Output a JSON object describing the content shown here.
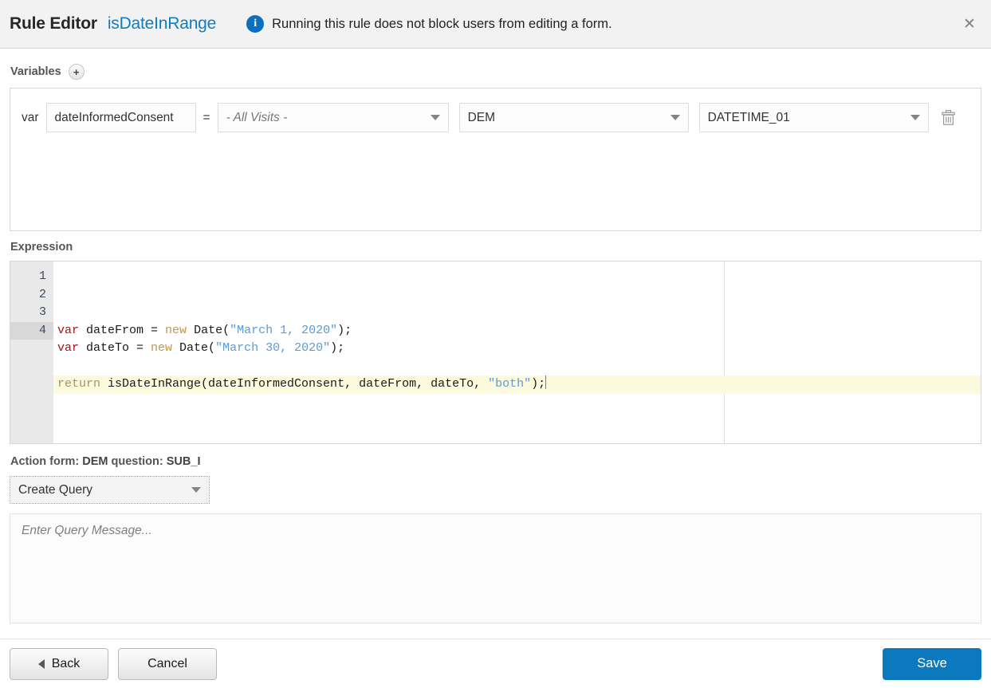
{
  "header": {
    "title": "Rule Editor",
    "rule_name": "isDateInRange",
    "info_icon": "info-circle-icon",
    "note": "Running this rule does not block users from editing a form.",
    "close_label": "✕"
  },
  "variables": {
    "label": "Variables",
    "add_label": "+",
    "rows": [
      {
        "keyword": "var",
        "name": "dateInformedConsent",
        "equals": "=",
        "visit": "- All Visits -",
        "visit_is_placeholder": true,
        "form": "DEM",
        "item": "DATETIME_01",
        "delete_icon": "trash-icon"
      }
    ]
  },
  "expression": {
    "label": "Expression",
    "active_line": 4,
    "cursor_line": 4,
    "lines": [
      {
        "number": "1",
        "tokens": [
          {
            "t": "var ",
            "c": "tok-kw"
          },
          {
            "t": "dateFrom = ",
            "c": "tok-plain"
          },
          {
            "t": "new ",
            "c": "tok-new"
          },
          {
            "t": "Date(",
            "c": "tok-plain"
          },
          {
            "t": "\"March 1, 2020\"",
            "c": "tok-str"
          },
          {
            "t": ");",
            "c": "tok-plain"
          }
        ]
      },
      {
        "number": "2",
        "tokens": [
          {
            "t": "var ",
            "c": "tok-kw"
          },
          {
            "t": "dateTo = ",
            "c": "tok-plain"
          },
          {
            "t": "new ",
            "c": "tok-new"
          },
          {
            "t": "Date(",
            "c": "tok-plain"
          },
          {
            "t": "\"March 30, 2020\"",
            "c": "tok-str"
          },
          {
            "t": ");",
            "c": "tok-plain"
          }
        ]
      },
      {
        "number": "3",
        "tokens": []
      },
      {
        "number": "4",
        "tokens": [
          {
            "t": "return ",
            "c": "tok-ret"
          },
          {
            "t": "isDateInRange(dateInformedConsent, dateFrom, dateTo, ",
            "c": "tok-plain"
          },
          {
            "t": "\"both\"",
            "c": "tok-str"
          },
          {
            "t": ");",
            "c": "tok-plain"
          }
        ]
      }
    ]
  },
  "action": {
    "prefix": "Action form:",
    "form": "DEM",
    "middle": "question:",
    "question": "SUB_I",
    "selected_action": "Create Query",
    "query_placeholder": "Enter Query Message..."
  },
  "footer": {
    "back_label": "Back",
    "cancel_label": "Cancel",
    "save_label": "Save"
  },
  "colors": {
    "accent_blue": "#0c78bd",
    "rule_link": "#0f7dc2",
    "header_bg": "#f2f2f2",
    "active_line": "#fcfadd",
    "gutter_bg": "#e9e9e9"
  }
}
